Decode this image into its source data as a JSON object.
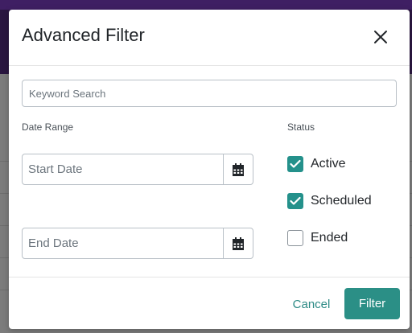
{
  "modal": {
    "title": "Advanced Filter",
    "close_icon": "close-icon"
  },
  "keyword": {
    "placeholder": "Keyword Search",
    "value": ""
  },
  "date_range": {
    "label": "Date Range",
    "start": {
      "placeholder": "Start Date",
      "value": "",
      "icon": "calendar-icon"
    },
    "end": {
      "placeholder": "End Date",
      "value": "",
      "icon": "calendar-icon"
    }
  },
  "status": {
    "label": "Status",
    "options": [
      {
        "label": "Active",
        "checked": true
      },
      {
        "label": "Scheduled",
        "checked": true
      },
      {
        "label": "Ended",
        "checked": false
      }
    ]
  },
  "footer": {
    "cancel_label": "Cancel",
    "filter_label": "Filter"
  },
  "colors": {
    "accent": "#2b8f86",
    "checkbox_checked": "#24918b",
    "app_header": "#2a1640",
    "overlay": "#7b7b7b"
  }
}
